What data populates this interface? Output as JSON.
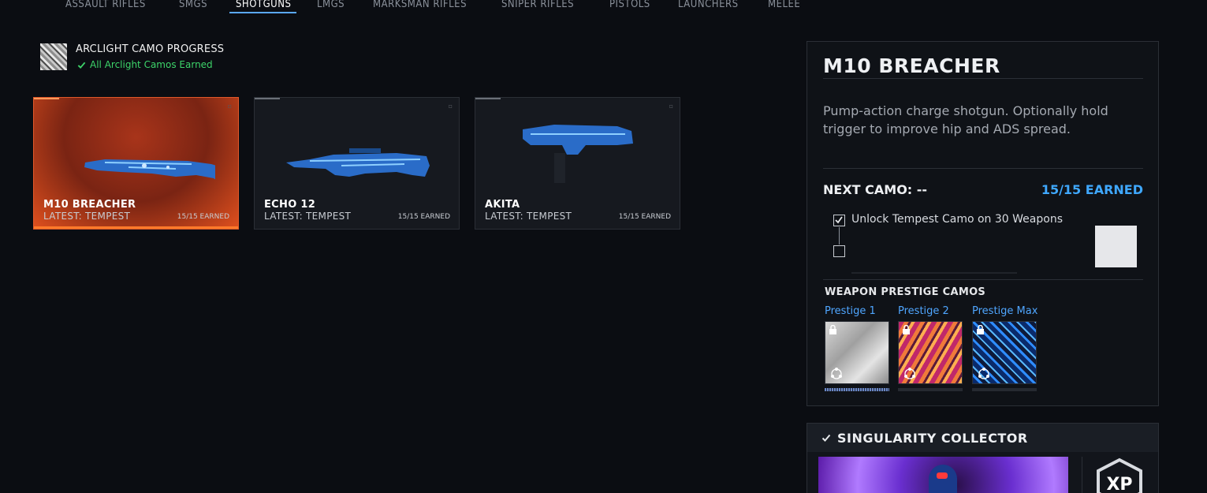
{
  "tabs": [
    {
      "label": "ASSAULT RIFLES",
      "active": false
    },
    {
      "label": "SMGS",
      "active": false
    },
    {
      "label": "SHOTGUNS",
      "active": true
    },
    {
      "label": "LMGS",
      "active": false
    },
    {
      "label": "MARKSMAN RIFLES",
      "active": false
    },
    {
      "label": "SNIPER RIFLES",
      "active": false
    },
    {
      "label": "PISTOLS",
      "active": false
    },
    {
      "label": "LAUNCHERS",
      "active": false
    },
    {
      "label": "MELEE",
      "active": false
    }
  ],
  "arclight": {
    "title": "ARCLIGHT CAMO PROGRESS",
    "status": "All Arclight Camos Earned",
    "status_color": "#3dd46a"
  },
  "weapons": [
    {
      "name": "M10 BREACHER",
      "latest": "LATEST: TEMPEST",
      "earned": "15/15 EARNED",
      "selected": true
    },
    {
      "name": "ECHO 12",
      "latest": "LATEST: TEMPEST",
      "earned": "15/15 EARNED",
      "selected": false
    },
    {
      "name": "AKITA",
      "latest": "LATEST: TEMPEST",
      "earned": "15/15 EARNED",
      "selected": false
    }
  ],
  "detail": {
    "title": "M10 BREACHER",
    "description": "Pump-action charge shotgun. Optionally hold trigger to improve hip and ADS spread.",
    "next_camo": "NEXT CAMO: --",
    "earned": "15/15 EARNED",
    "challenge": "Unlock Tempest Camo on 30 Weapons",
    "challenge_checked": true,
    "prestige_title": "WEAPON PRESTIGE CAMOS",
    "prestige": [
      {
        "label": "Prestige 1",
        "locked": true
      },
      {
        "label": "Prestige 2",
        "locked": true
      },
      {
        "label": "Prestige Max",
        "locked": true
      }
    ]
  },
  "collector": {
    "title": "SINGULARITY COLLECTOR",
    "badge": "XP"
  },
  "colors": {
    "accent_blue": "#3fa8ff",
    "selected_orange": "#e0582a",
    "success_green": "#3dd46a"
  }
}
